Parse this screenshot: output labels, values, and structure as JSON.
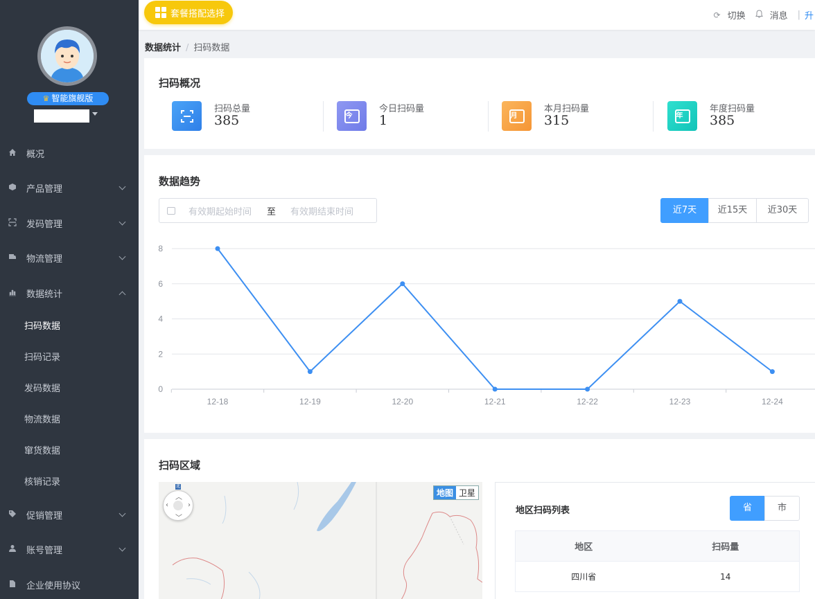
{
  "sidebar": {
    "vip_label": "智能旗舰版",
    "menu": [
      {
        "label": "概况",
        "icon": "home-icon"
      },
      {
        "label": "产品管理",
        "icon": "cube-icon"
      },
      {
        "label": "发码管理",
        "icon": "scan-icon"
      },
      {
        "label": "物流管理",
        "icon": "truck-icon"
      },
      {
        "label": "数据统计",
        "icon": "bar-chart-icon"
      },
      {
        "label": "促销管理",
        "icon": "tag-icon"
      },
      {
        "label": "账号管理",
        "icon": "user-icon"
      },
      {
        "label": "企业使用协议",
        "icon": "document-icon"
      }
    ],
    "submenu": [
      "扫码数据",
      "扫码记录",
      "发码数据",
      "物流数据",
      "窜货数据",
      "核销记录"
    ]
  },
  "topbar": {
    "package_button": "套餐搭配选择",
    "switch_label": "切换",
    "messages_label": "消息",
    "upgrade_label": "升"
  },
  "breadcrumb": {
    "parent": "数据统计",
    "current": "扫码数据"
  },
  "overview": {
    "title": "扫码概况",
    "stats": [
      {
        "label": "扫码总量",
        "value": "385",
        "icon": "scan-frame-icon",
        "color": "#3d8ff2"
      },
      {
        "label": "今日扫码量",
        "value": "1",
        "icon": "calendar-today-icon",
        "icon_text": "今",
        "color": "#7f8cf0"
      },
      {
        "label": "本月扫码量",
        "value": "315",
        "icon": "calendar-month-icon",
        "icon_text": "月",
        "color": "#f8a64a"
      },
      {
        "label": "年度扫码量",
        "value": "385",
        "icon": "calendar-year-icon",
        "icon_text": "年",
        "color": "#1fd3c4"
      }
    ]
  },
  "trend": {
    "title": "数据趋势",
    "start_placeholder": "有效期起始时间",
    "to_label": "至",
    "end_placeholder": "有效期结束时间",
    "ranges": [
      "近7天",
      "近15天",
      "近30天"
    ],
    "active_range": "近7天"
  },
  "chart_data": {
    "type": "line",
    "x": [
      "12-18",
      "12-19",
      "12-20",
      "12-21",
      "12-22",
      "12-23",
      "12-24"
    ],
    "series": [
      {
        "values": [
          8,
          1,
          6,
          0,
          0,
          5,
          1
        ],
        "color": "#3d8ff2"
      }
    ],
    "ylim": [
      0,
      8
    ],
    "yticks": [
      0,
      2,
      4,
      6,
      8
    ],
    "grid": true
  },
  "region": {
    "title": "扫码区域",
    "map_toggle": [
      "地图",
      "卫星"
    ],
    "list_title": "地区扫码列表",
    "level_buttons": [
      "省",
      "市"
    ],
    "columns": [
      "地区",
      "扫码量"
    ],
    "rows": [
      [
        "四川省",
        "14"
      ]
    ]
  }
}
